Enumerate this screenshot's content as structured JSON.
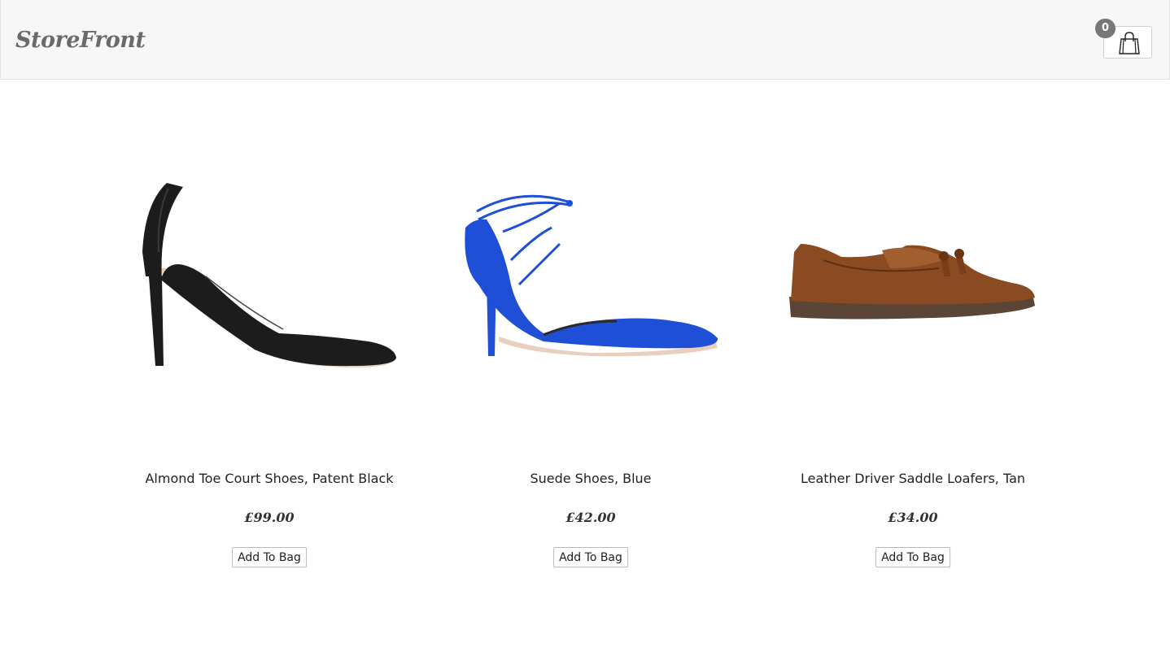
{
  "header": {
    "logo": "StoreFront",
    "bag_count": "0"
  },
  "products": [
    {
      "title": "Almond Toe Court Shoes, Patent Black",
      "price": "£99.00",
      "button_label": "Add To Bag",
      "image": "black-court-shoe"
    },
    {
      "title": "Suede Shoes, Blue",
      "price": "£42.00",
      "button_label": "Add To Bag",
      "image": "blue-suede-heel"
    },
    {
      "title": "Leather Driver Saddle Loafers, Tan",
      "price": "£34.00",
      "button_label": "Add To Bag",
      "image": "tan-tassel-loafer"
    }
  ],
  "colors": {
    "header_bg": "#f7f7f7",
    "badge_bg": "#777777",
    "black_shoe": "#1c1c1c",
    "blue_shoe": "#1f4fd6",
    "tan_shoe": "#8a4a22"
  }
}
